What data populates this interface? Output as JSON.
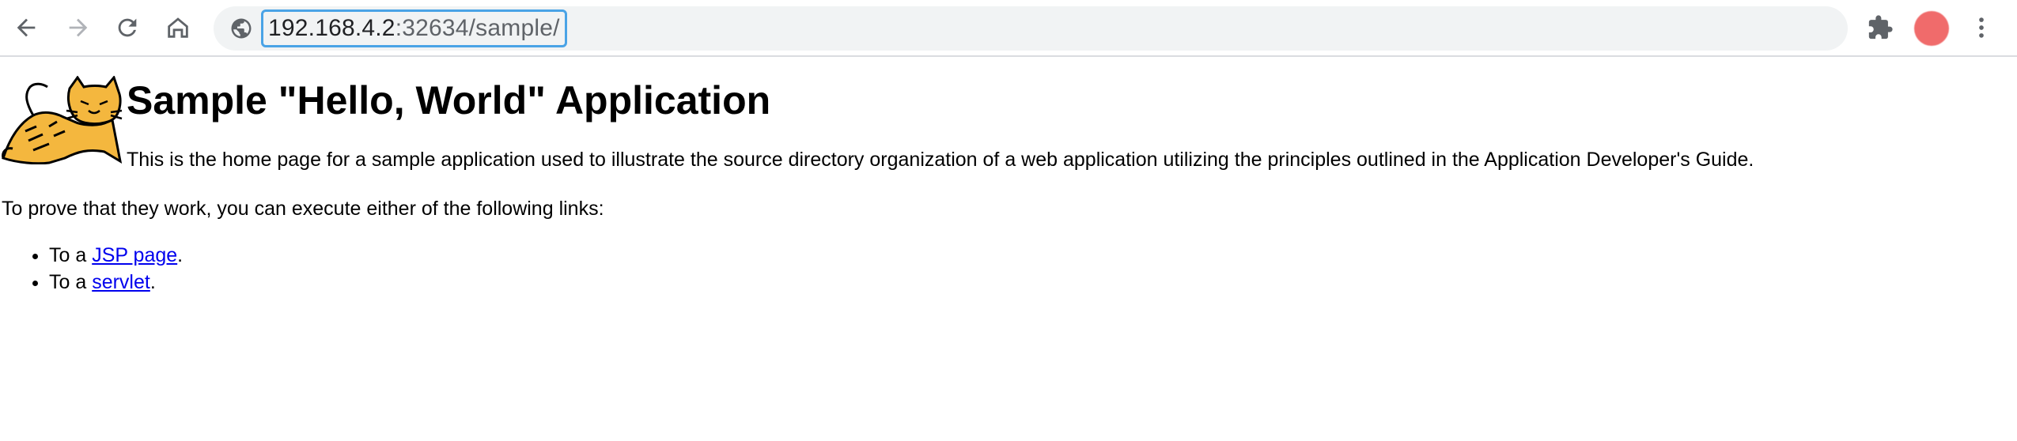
{
  "browser": {
    "url_host": "192.168.4.2",
    "url_rest": ":32634/sample/",
    "colors": {
      "toolbar_bg": "#ffffff",
      "omnibox_bg": "#f1f3f4",
      "focus_ring": "#4aa3e6",
      "avatar": "#f06b6b"
    },
    "icons": [
      "back-icon",
      "forward-icon",
      "reload-icon",
      "home-icon",
      "site-info-icon",
      "extensions-icon",
      "avatar",
      "more-menu-icon"
    ]
  },
  "page": {
    "title": "Sample \"Hello, World\" Application",
    "intro": "This is the home page for a sample application used to illustrate the source directory organization of a web application utilizing the principles outlined in the Application Developer's Guide.",
    "prove_text": "To prove that they work, you can execute either of the following links:",
    "links": [
      {
        "prefix": "To a ",
        "label": "JSP page",
        "suffix": "."
      },
      {
        "prefix": "To a ",
        "label": "servlet",
        "suffix": "."
      }
    ],
    "link_color": "#0000ee"
  }
}
